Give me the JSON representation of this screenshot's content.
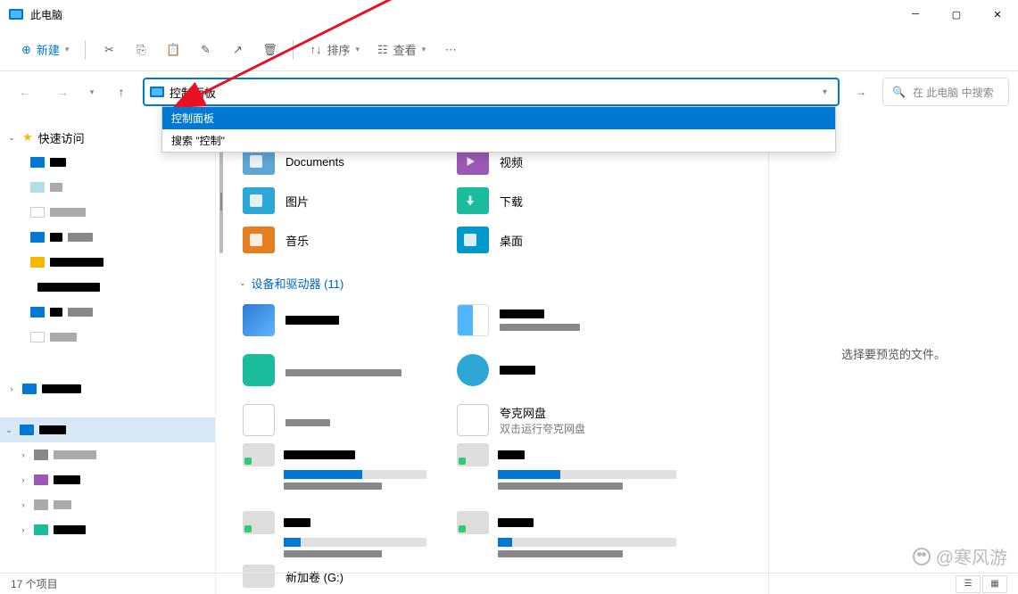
{
  "title_bar": {
    "title": "此电脑"
  },
  "toolbar": {
    "new_label": "新建",
    "sort_label": "排序",
    "view_label": "查看"
  },
  "address": {
    "value": "控制面板",
    "search_placeholder": "在 此电脑 中搜索",
    "suggestions": [
      {
        "label": "控制面板",
        "selected": true
      },
      {
        "label": "搜索 \"控制\"",
        "selected": false
      }
    ]
  },
  "sidebar": {
    "quick_access": "快速访问"
  },
  "folders": [
    {
      "name": "Documents",
      "icon": "doc"
    },
    {
      "name": "视频",
      "icon": "vid"
    },
    {
      "name": "图片",
      "icon": "pic"
    },
    {
      "name": "下载",
      "icon": "dl"
    },
    {
      "name": "音乐",
      "icon": "mus"
    },
    {
      "name": "桌面",
      "icon": "desk"
    }
  ],
  "devices_section": {
    "title": "设备和驱动器 (11)"
  },
  "quark": {
    "name": "夸克网盘",
    "subtitle": "双击运行夸克网盘"
  },
  "drive_g": "新加卷 (G:)",
  "preview": {
    "placeholder": "选择要预览的文件。"
  },
  "status": {
    "items": "17 个项目"
  },
  "watermark": "@寒风游"
}
